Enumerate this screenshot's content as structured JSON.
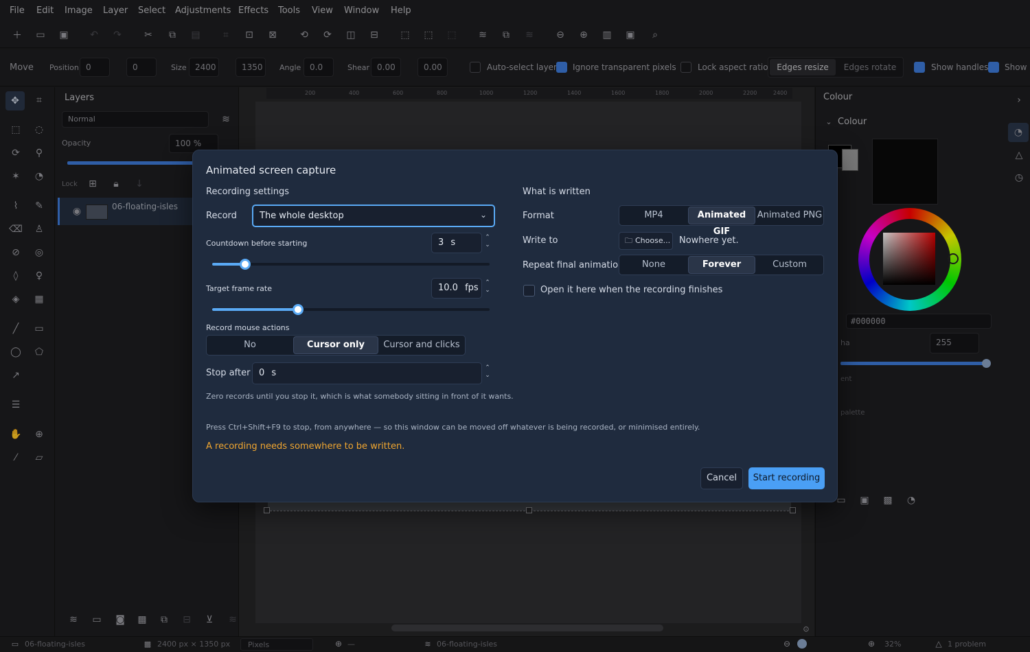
{
  "menu": [
    "File",
    "Edit",
    "Image",
    "Layer",
    "Select",
    "Adjustments",
    "Effects",
    "Tools",
    "View",
    "Window",
    "Help"
  ],
  "options": {
    "tool": "Move",
    "position_label": "Position",
    "pos_x": "0",
    "pos_y": "0",
    "size_label": "Size",
    "width": "2400",
    "height": "1350",
    "angle_label": "Angle",
    "angle": "0.0",
    "shear_label": "Shear",
    "shear_x": "0.00",
    "shear_y": "0.00",
    "auto_select": "Auto-select layer",
    "ignore_transparent": "Ignore transparent pixels",
    "lock_aspect": "Lock aspect ratio",
    "edges_resize": "Edges resize",
    "edges_rotate": "Edges rotate",
    "show_handles": "Show handles",
    "show_extra": "Show"
  },
  "layers": {
    "title": "Layers",
    "blend": "Normal",
    "opacity_label": "Opacity",
    "opacity": "100 %",
    "lock_label": "Lock",
    "layer_name": "06-floating-isles"
  },
  "ruler_ticks": [
    "200",
    "400",
    "600",
    "800",
    "1000",
    "1200",
    "1400",
    "1600",
    "1800",
    "2000",
    "2200",
    "2400"
  ],
  "colour": {
    "panel_title": "Colour",
    "section": "Colour",
    "hex": "#000000",
    "alpha_label": "ha",
    "alpha": "255",
    "recent_label": "ent",
    "palette_label": "palette"
  },
  "status": {
    "doc": "06-floating-isles",
    "dims": "2400 px × 1350 px",
    "units": "Pixels",
    "coords": "—",
    "layer": "06-floating-isles",
    "zoom": "32%",
    "problems": "1 problem"
  },
  "dialog": {
    "title": "Animated screen capture",
    "recording_heading": "Recording settings",
    "record_label": "Record",
    "record_value": "The whole desktop",
    "countdown_label": "Countdown before starting",
    "countdown_value": "3",
    "countdown_unit": "s",
    "countdown_fraction": 0.12,
    "framerate_label": "Target frame rate",
    "framerate_value": "10.0",
    "framerate_unit": "fps",
    "framerate_fraction": 0.31,
    "mouse_label": "Record mouse actions",
    "mouse_options": [
      "No",
      "Cursor only",
      "Cursor and clicks"
    ],
    "mouse_selected": 1,
    "stop_label": "Stop after",
    "stop_value": "0",
    "stop_unit": "s",
    "stop_hint": "Zero records until you stop it, which is what somebody sitting in front of it wants.",
    "written_heading": "What is written",
    "format_label": "Format",
    "format_options": [
      "MP4",
      "Animated GIF",
      "Animated PNG"
    ],
    "format_selected": 1,
    "write_to_label": "Write to",
    "choose_label": "Choose...",
    "write_to_value": "Nowhere yet.",
    "repeat_label": "Repeat final animation",
    "repeat_options": [
      "None",
      "Forever",
      "Custom"
    ],
    "repeat_selected": 1,
    "open_when_done": "Open it here when the recording finishes",
    "shortcut_hint": "Press Ctrl+Shift+F9 to stop, from anywhere — so this window can be moved off whatever is being recorded, or minimised entirely.",
    "warning": "A recording needs somewhere to be written.",
    "cancel": "Cancel",
    "start": "Start recording"
  },
  "colors": {
    "accent": "#5aaaf5",
    "primary_button": "#4a9ff5",
    "warning": "#f0a630",
    "dialog_bg": "#1f2b3e"
  }
}
